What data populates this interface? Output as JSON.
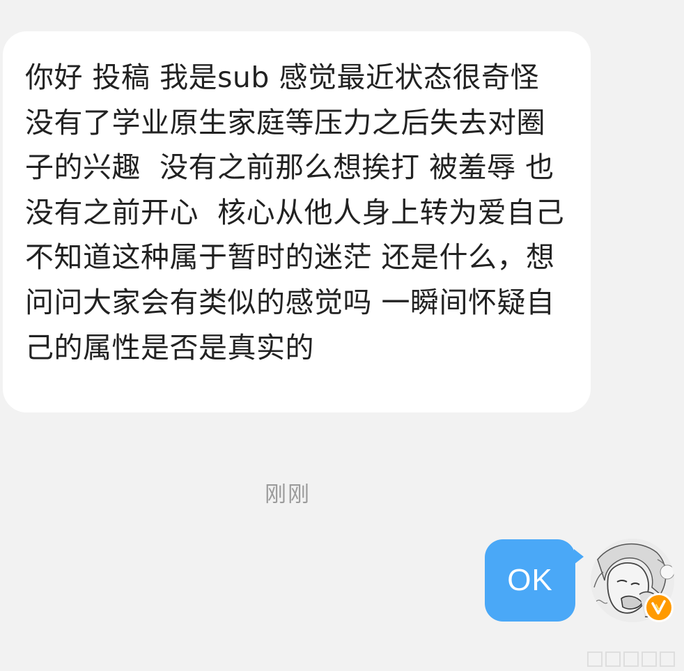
{
  "messages": {
    "incoming": {
      "text": "你好 投稿 我是sub 感觉最近状态很奇怪 没有了学业原生家庭等压力之后失去对圈子的兴趣  没有之前那么想挨打 被羞辱 也没有之前开心  核心从他人身上转为爱自己 不知道这种属于暂时的迷茫 还是什么，想问问大家会有类似的感觉吗 一瞬间怀疑自己的属性是否是真实的"
    },
    "timestamp": "刚刚",
    "outgoing": {
      "text": "OK"
    }
  },
  "avatar": {
    "icon": "avatar-portrait",
    "badge_icon": "verified-v-icon",
    "badge_color": "#ff9a00"
  },
  "colors": {
    "background": "#f2f2f2",
    "incoming_bubble": "#ffffff",
    "outgoing_bubble": "#4aa8f7",
    "timestamp": "#9b9b9b"
  }
}
